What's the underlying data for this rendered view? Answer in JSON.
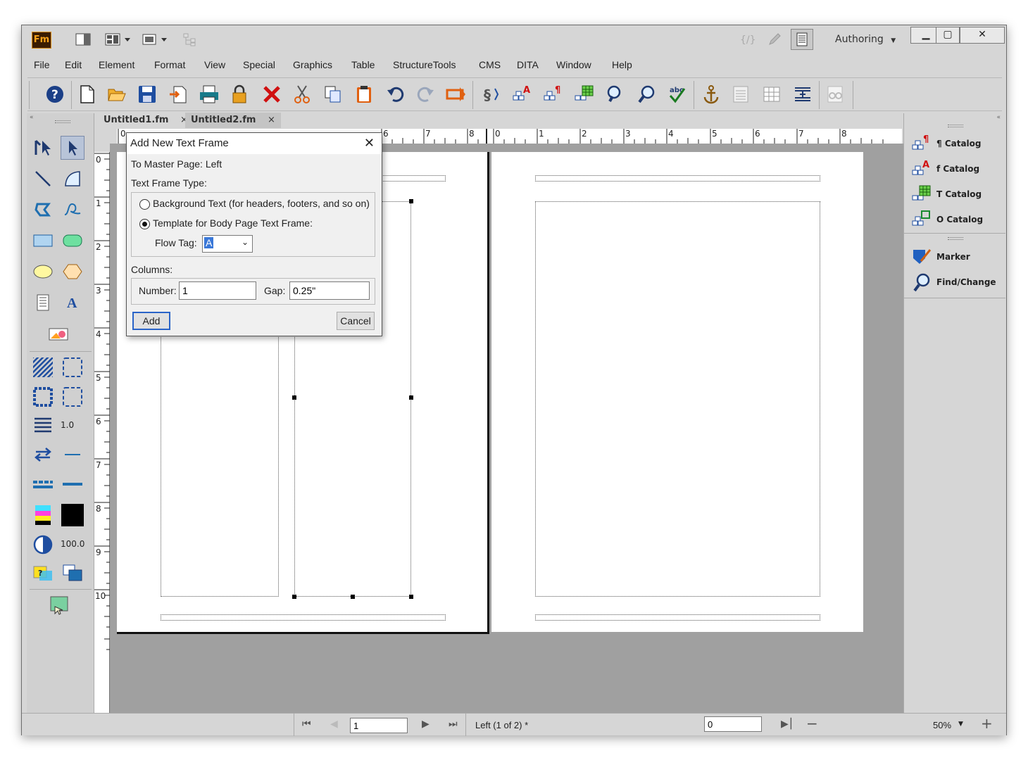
{
  "app": {
    "logo": "Fm",
    "workspace": "Authoring"
  },
  "menu": [
    "File",
    "Edit",
    "Element",
    "Format",
    "View",
    "Special",
    "Graphics",
    "Table",
    "StructureTools",
    "CMS",
    "DITA",
    "Window",
    "Help"
  ],
  "tabs": [
    {
      "label": "Untitled1.fm",
      "close": "×"
    },
    {
      "label": "Untitled2.fm",
      "close": "×"
    }
  ],
  "left_panel": {
    "line_width": "1.0",
    "tint": "100.0"
  },
  "vruler_ticks": [
    "0",
    "1",
    "2",
    "3",
    "4",
    "5",
    "6",
    "7",
    "8",
    "9",
    "10"
  ],
  "hruler_ticks_left": [
    "0",
    "6",
    "7",
    "8"
  ],
  "hruler_ticks_right": [
    "0",
    "1",
    "2",
    "3",
    "4",
    "5",
    "6",
    "7",
    "8"
  ],
  "right_panel": {
    "items": [
      {
        "label": "¶ Catalog",
        "icon": "paragraph-catalog-icon"
      },
      {
        "label": "f Catalog",
        "icon": "character-catalog-icon"
      },
      {
        "label": "T Catalog",
        "icon": "table-catalog-icon"
      },
      {
        "label": "O Catalog",
        "icon": "object-catalog-icon"
      },
      {
        "label": "Marker",
        "icon": "marker-icon"
      },
      {
        "label": "Find/Change",
        "icon": "find-change-icon"
      }
    ]
  },
  "dialog": {
    "title": "Add New Text Frame",
    "master_page": "To Master Page:  Left",
    "frame_type_label": "Text Frame Type:",
    "option_background": "Background Text (for headers, footers, and so on)",
    "option_template": "Template for Body Page Text Frame:",
    "flow_tag_label": "Flow Tag:",
    "flow_tag_value": "A",
    "columns_label": "Columns:",
    "number_label": "Number:",
    "number_value": "1",
    "gap_label": "Gap:",
    "gap_value": "0.25\"",
    "add_label": "Add",
    "cancel_label": "Cancel"
  },
  "status": {
    "page_input": "1",
    "page_info": "Left (1 of 2) *",
    "field2": "0",
    "zoom": "50%"
  }
}
